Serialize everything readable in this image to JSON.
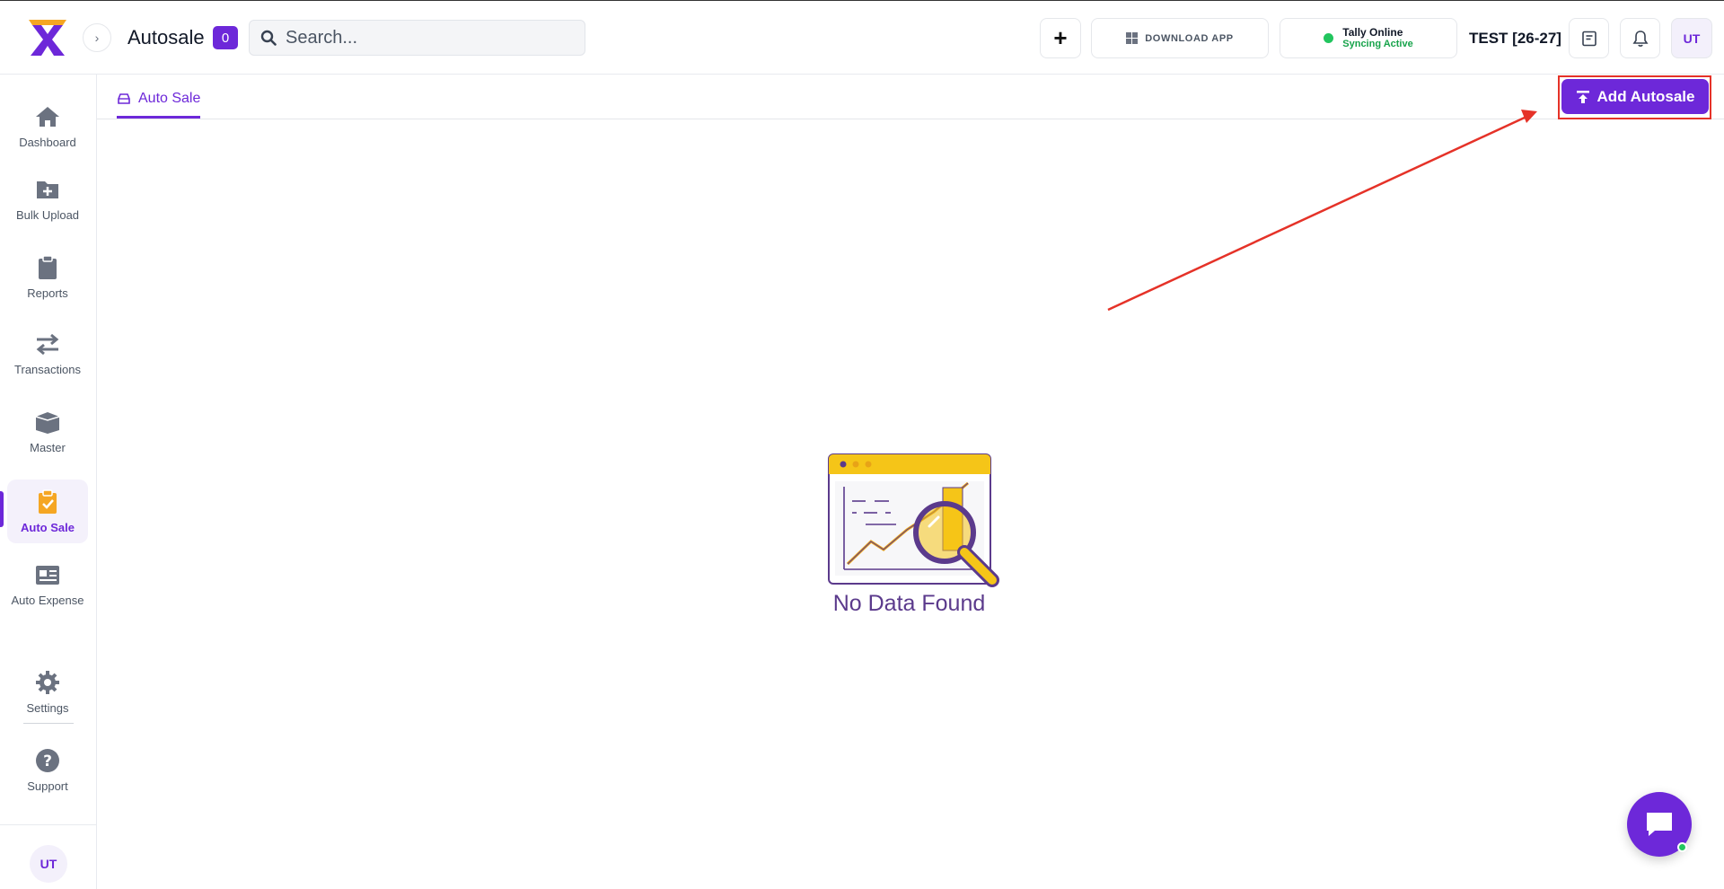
{
  "header": {
    "title": "Autosale",
    "count": "0",
    "search_placeholder": "Search...",
    "download_label": "DOWNLOAD APP",
    "tally_title": "Tally Online",
    "tally_status": "Syncing Active",
    "company": "TEST [26-27]",
    "user_initials": "UT"
  },
  "sidebar": {
    "items": [
      {
        "label": "Dashboard",
        "icon": "home-icon"
      },
      {
        "label": "Bulk Upload",
        "icon": "folder-plus-icon"
      },
      {
        "label": "Reports",
        "icon": "clipboard-icon"
      },
      {
        "label": "Transactions",
        "icon": "arrows-exchange-icon"
      },
      {
        "label": "Master",
        "icon": "box-icon"
      },
      {
        "label": "Auto Sale",
        "icon": "clipboard-check-icon"
      },
      {
        "label": "Auto Expense",
        "icon": "id-card-icon"
      },
      {
        "label": "Settings",
        "icon": "gear-icon"
      },
      {
        "label": "Support",
        "icon": "question-icon"
      }
    ],
    "active": "Auto Sale",
    "user_initials": "UT"
  },
  "main": {
    "tab_label": "Auto Sale",
    "add_button_label": "Add Autosale",
    "empty_text": "No Data Found"
  },
  "colors": {
    "accent": "#6d28d9",
    "annotation": "#e53228",
    "online": "#22c55e"
  }
}
